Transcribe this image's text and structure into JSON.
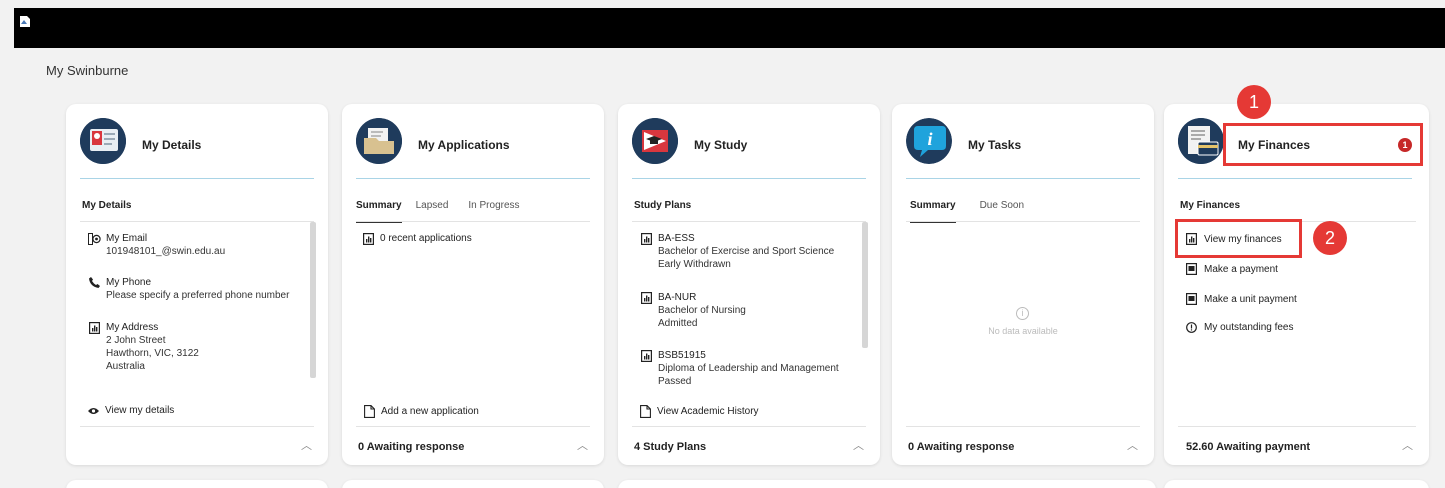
{
  "page": {
    "title": "My Swinburne"
  },
  "cards": {
    "details": {
      "title": "My Details",
      "section": "My Details",
      "items": [
        {
          "label": "My Email",
          "lines": [
            "101948101_@swin.edu.au"
          ]
        },
        {
          "label": "My Phone",
          "lines": [
            "Please specify a preferred phone number"
          ]
        },
        {
          "label": "My Address",
          "lines": [
            "2 John Street",
            "Hawthorn, VIC, 3122",
            "Australia"
          ]
        }
      ],
      "footer_link": "View my details"
    },
    "applications": {
      "title": "My Applications",
      "tabs": [
        "Summary",
        "Lapsed",
        "In Progress"
      ],
      "items": [
        {
          "label": "0 recent applications"
        }
      ],
      "footer_link": "Add a new application",
      "status": "0  Awaiting response"
    },
    "study": {
      "title": "My Study",
      "section": "Study Plans",
      "items": [
        {
          "label": "BA-ESS",
          "lines": [
            "Bachelor of Exercise and Sport Science",
            "Early Withdrawn"
          ]
        },
        {
          "label": "BA-NUR",
          "lines": [
            "Bachelor of Nursing",
            "Admitted"
          ]
        },
        {
          "label": "BSB51915",
          "lines": [
            "Diploma of Leadership and Management",
            "Passed"
          ]
        }
      ],
      "footer_link": "View Academic History",
      "status": "4  Study Plans"
    },
    "tasks": {
      "title": "My Tasks",
      "tabs": [
        "Summary",
        "Due Soon"
      ],
      "empty": "No data available",
      "status": "0  Awaiting response"
    },
    "finances": {
      "title": "My Finances",
      "badge": "1",
      "section": "My Finances",
      "items": [
        "View my finances",
        "Make a payment",
        "Make a unit payment",
        "My outstanding fees"
      ],
      "status": "52.60  Awaiting payment"
    }
  },
  "annotations": {
    "marker1": "1",
    "marker2": "2"
  },
  "colors": {
    "accent_rule": "#a9d4e6",
    "highlight": "#e53935",
    "topbar": "#000000"
  }
}
